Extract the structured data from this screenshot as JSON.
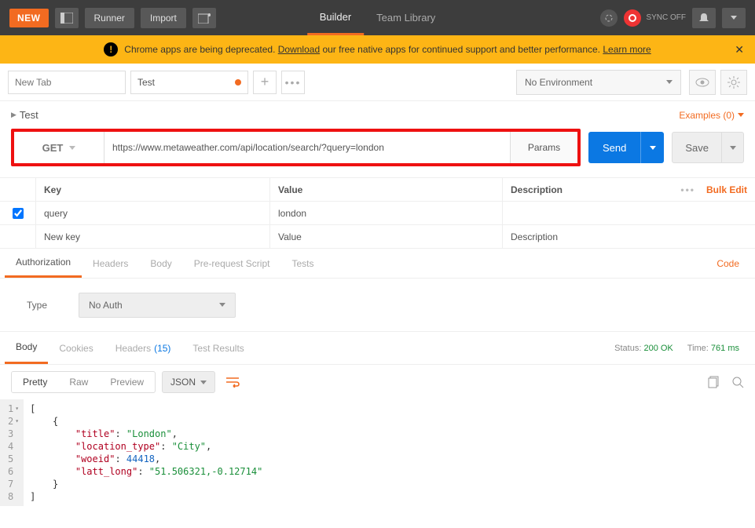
{
  "topbar": {
    "new": "NEW",
    "runner": "Runner",
    "import": "Import",
    "builder": "Builder",
    "team_library": "Team Library",
    "sync": "SYNC OFF"
  },
  "banner": {
    "pre": "Chrome apps are being deprecated. ",
    "dl": "Download",
    "mid": " our free native apps for continued support and better performance.  ",
    "learn": "Learn more"
  },
  "env": {
    "new_tab_placeholder": "New Tab",
    "tab_name": "Test",
    "no_env": "No Environment"
  },
  "breadcrumb": {
    "name": "Test"
  },
  "examples": {
    "label": "Examples (0)"
  },
  "request": {
    "method": "GET",
    "url": "https://www.metaweather.com/api/location/search/?query=london",
    "params_btn": "Params",
    "send": "Send",
    "save": "Save"
  },
  "params": {
    "head_key": "Key",
    "head_value": "Value",
    "head_desc": "Description",
    "bulk": "Bulk Edit",
    "rows": [
      {
        "key": "query",
        "value": "london",
        "desc": ""
      }
    ],
    "ph_key": "New key",
    "ph_value": "Value",
    "ph_desc": "Description"
  },
  "reqtabs": {
    "auth": "Authorization",
    "headers": "Headers",
    "body": "Body",
    "prereq": "Pre-request Script",
    "tests": "Tests",
    "code": "Code"
  },
  "auth": {
    "type_label": "Type",
    "selected": "No Auth"
  },
  "resptabs": {
    "body": "Body",
    "cookies": "Cookies",
    "headers": "Headers",
    "hcount": "(15)",
    "tests": "Test Results"
  },
  "respmeta": {
    "status_lbl": "Status:",
    "status_val": "200 OK",
    "time_lbl": "Time:",
    "time_val": "761 ms"
  },
  "resptool": {
    "pretty": "Pretty",
    "raw": "Raw",
    "preview": "Preview",
    "fmt": "JSON"
  },
  "response_json": [
    {
      "title": "London",
      "location_type": "City",
      "woeid": 44418,
      "latt_long": "51.506321,-0.12714"
    }
  ]
}
